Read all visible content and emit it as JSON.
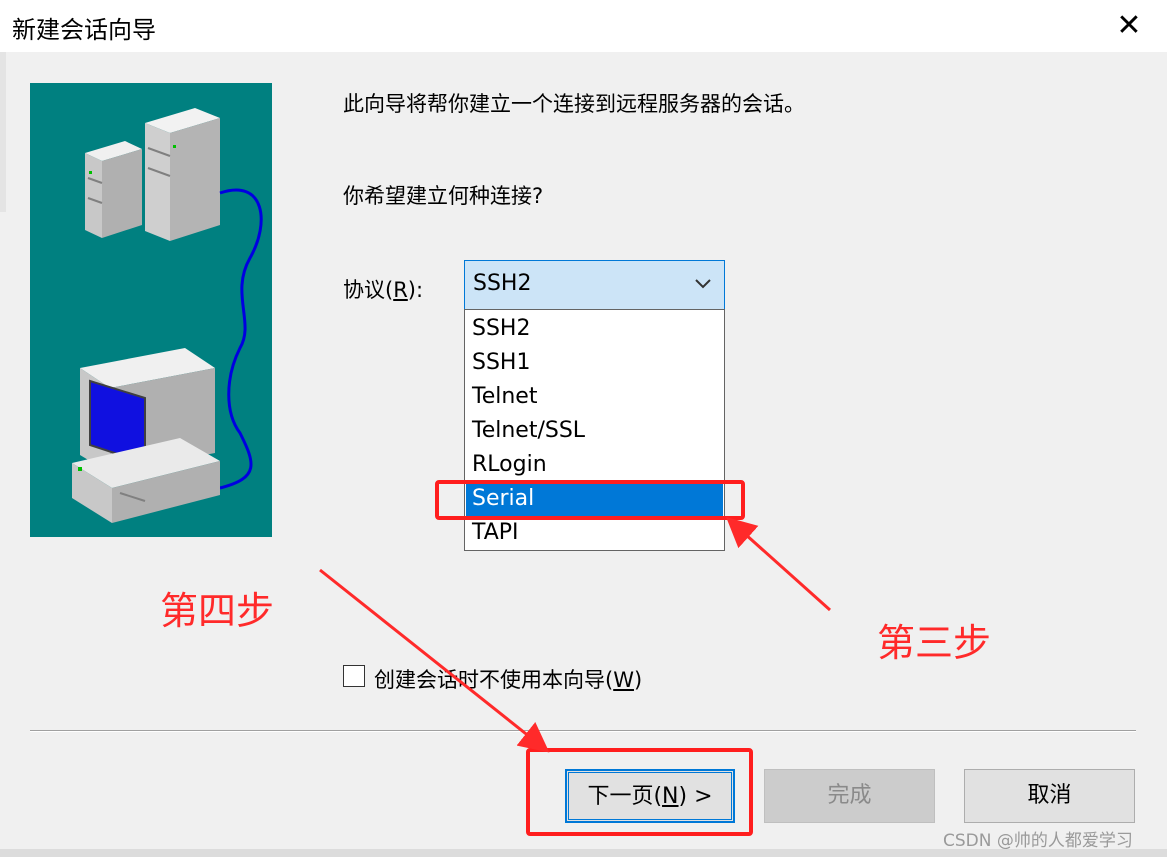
{
  "window": {
    "title": "新建会话向导",
    "close_symbol": "✕"
  },
  "intro_text": "此向导将帮你建立一个连接到远程服务器的会话。",
  "question_text": "你希望建立何种连接?",
  "protocol": {
    "label": "协议(R):",
    "selected": "SSH2",
    "options": [
      "SSH2",
      "SSH1",
      "Telnet",
      "Telnet/SSL",
      "RLogin",
      "Serial",
      "TAPI"
    ],
    "highlighted": "Serial"
  },
  "checkbox": {
    "label": "创建会话时不使用本向导(W)",
    "checked": false
  },
  "buttons": {
    "next": "下一页(N) >",
    "finish": "完成",
    "cancel": "取消"
  },
  "annotations": {
    "step3": "第三步",
    "step4": "第四步",
    "color": "#ff2a2a"
  },
  "watermark": "CSDN @帅的人都爱学习",
  "colors": {
    "accent": "#0078d7",
    "picture_bg": "#008080",
    "annotation": "#ff2a2a"
  }
}
